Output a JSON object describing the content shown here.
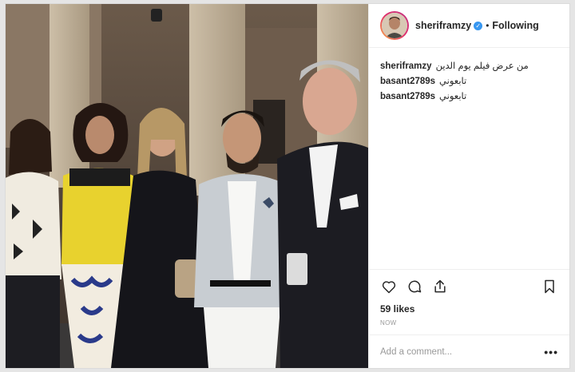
{
  "post": {
    "author": "sherifr",
    "author_full": "sheriframzy",
    "follow_state": "Following",
    "separator": "•",
    "verified_mark": "✓"
  },
  "comments": [
    {
      "user": "sheriframzy",
      "text": "من عرض فيلم يوم الدين"
    },
    {
      "user": "basant2789s",
      "text": "تابعوني"
    },
    {
      "user": "basant2789s",
      "text": "تابعوني"
    }
  ],
  "actions": {
    "icons": [
      "heart-icon",
      "comment-icon",
      "share-icon",
      "bookmark-icon"
    ]
  },
  "likes_text": "59 likes",
  "timestamp": "NOW",
  "add_comment": {
    "placeholder": "Add a comment...",
    "more": "•••"
  },
  "colors": {
    "verified": "#3897f0",
    "text": "#262626",
    "muted": "#999999",
    "border": "#efefef"
  }
}
